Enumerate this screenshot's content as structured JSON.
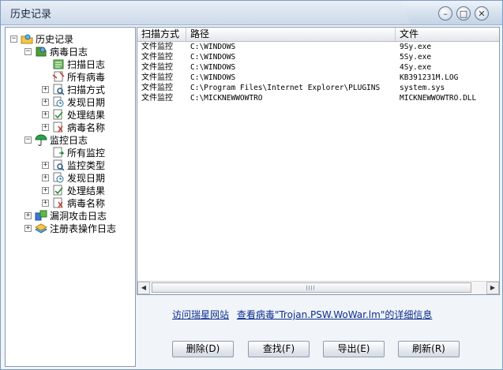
{
  "window": {
    "title": "历史记录",
    "controls": {
      "minimize_glyph": "–",
      "maximize_glyph": "□",
      "close_glyph": "✕"
    }
  },
  "tree": {
    "items": [
      {
        "label": "历史记录",
        "icon": "history-folder-icon",
        "expander": "−",
        "level": 0
      },
      {
        "label": "病毒日志",
        "icon": "virus-log-icon",
        "expander": "−",
        "level": 1
      },
      {
        "label": "扫描日志",
        "icon": "scan-log-icon",
        "expander": "",
        "level": 2
      },
      {
        "label": "所有病毒",
        "icon": "all-viruses-icon",
        "expander": "",
        "level": 2
      },
      {
        "label": "扫描方式",
        "icon": "scan-method-icon",
        "expander": "+",
        "level": 2
      },
      {
        "label": "发现日期",
        "icon": "clock-icon",
        "expander": "+",
        "level": 2
      },
      {
        "label": "处理结果",
        "icon": "result-icon",
        "expander": "+",
        "level": 2
      },
      {
        "label": "病毒名称",
        "icon": "virus-name-icon",
        "expander": "+",
        "level": 2
      },
      {
        "label": "监控日志",
        "icon": "monitor-umbrella-icon",
        "expander": "−",
        "level": 1
      },
      {
        "label": "所有监控",
        "icon": "all-monitor-icon",
        "expander": "",
        "level": 2
      },
      {
        "label": "监控类型",
        "icon": "monitor-type-icon",
        "expander": "+",
        "level": 2
      },
      {
        "label": "发现日期",
        "icon": "clock-icon",
        "expander": "+",
        "level": 2
      },
      {
        "label": "处理结果",
        "icon": "result-icon",
        "expander": "+",
        "level": 2
      },
      {
        "label": "病毒名称",
        "icon": "virus-name-icon",
        "expander": "+",
        "level": 2
      },
      {
        "label": "漏洞攻击日志",
        "icon": "exploit-log-icon",
        "expander": "+",
        "level": 1
      },
      {
        "label": "注册表操作日志",
        "icon": "registry-log-icon",
        "expander": "+",
        "level": 1
      }
    ]
  },
  "table": {
    "columns": [
      "扫描方式",
      "路径",
      "文件"
    ],
    "rows": [
      [
        "文件监控",
        "C:\\WINDOWS",
        "9Sy.exe"
      ],
      [
        "文件监控",
        "C:\\WINDOWS",
        "5Sy.exe"
      ],
      [
        "文件监控",
        "C:\\WINDOWS",
        "4Sy.exe"
      ],
      [
        "文件监控",
        "C:\\WINDOWS",
        "KB391231M.LOG"
      ],
      [
        "文件监控",
        "C:\\Program Files\\Internet Explorer\\PLUGINS",
        "system.sys"
      ],
      [
        "文件监控",
        "C:\\MICKNEWWOWTRO",
        "MICKNEWWOWTRO.DLL"
      ]
    ]
  },
  "links": {
    "visit_site": "访问瑞星网站",
    "virus_detail": "查看病毒\"Trojan.PSW.WoWar.lm\"的详细信息"
  },
  "buttons": {
    "delete": "删除(D)",
    "find": "查找(F)",
    "export": "导出(E)",
    "refresh": "刷新(R)"
  },
  "scrollbar": {
    "left_glyph": "◀",
    "right_glyph": "▶"
  },
  "colors": {
    "link": "#0b2e8f",
    "title_bar": "#d4e0ee",
    "border": "#7b9ec5"
  }
}
